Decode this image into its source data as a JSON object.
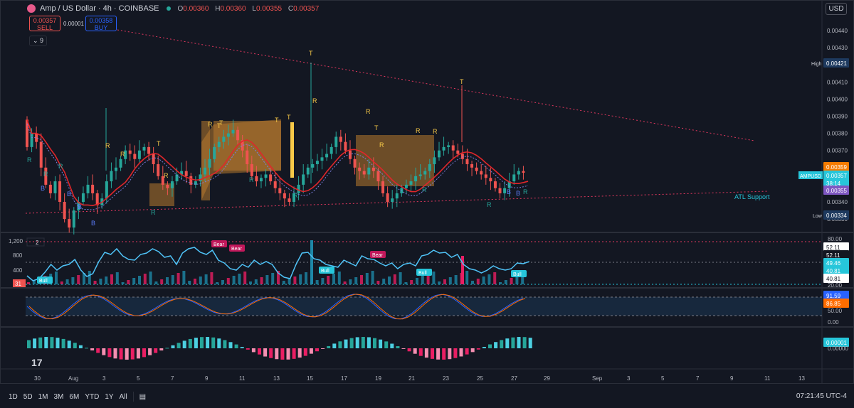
{
  "header": {
    "symbol": "Amp / US Dollar · 4h · COINBASE",
    "o_label": "O",
    "o_value": "0.00360",
    "h_label": "H",
    "h_value": "0.00360",
    "l_label": "L",
    "l_value": "0.00355",
    "c_label": "C",
    "c_value": "0.00357"
  },
  "trade": {
    "sell_price": "0.00357",
    "sell_label": "SELL",
    "buy_price": "0.00358",
    "buy_label": "BUY",
    "spread": "0.00001"
  },
  "collapse_label": "9",
  "currency": "USD",
  "price_axis": {
    "ticks": [
      "0.00440",
      "0.00430",
      "0.00420",
      "0.00410",
      "0.00400",
      "0.00390",
      "0.00380",
      "0.00370",
      "0.00360",
      "0.00350",
      "0.00340",
      "0.00330"
    ],
    "high_label": "High",
    "high_value": "0.00421",
    "low_label": "Low",
    "low_value": "0.00334",
    "tag_orange": "0.00359",
    "tag_symbol": "AMPUSD",
    "tag_price": "0.00357",
    "tag_timer": "38:14",
    "tag_purple": "0.00355"
  },
  "annotations": {
    "atl_support": "ATL Support",
    "t": "T",
    "r": "R",
    "b": "B"
  },
  "indicator1": {
    "pane_label": "2",
    "ticks": [
      "1,200",
      "800",
      "400"
    ],
    "value_badge": "31",
    "axis_top": "80.00",
    "tag1": "52.11",
    "tag2": "52.11",
    "tag3": "49.46",
    "tag4": "40.81",
    "tag5": "40.81",
    "axis_bottom": "20.00",
    "bull": "Bull",
    "bear": "Bear"
  },
  "indicator2": {
    "tag1": "91.59",
    "tag2": "86.85",
    "axis_mid": "50.00",
    "axis_bottom": "0.00"
  },
  "indicator3": {
    "tag1": "0.00001",
    "axis": "0.00000"
  },
  "time_axis": [
    "30",
    "Aug",
    "3",
    "5",
    "7",
    "9",
    "11",
    "13",
    "15",
    "17",
    "19",
    "21",
    "23",
    "25",
    "27",
    "29",
    "Sep",
    "3",
    "5",
    "7",
    "9",
    "11",
    "13"
  ],
  "timeframes": [
    "1D",
    "5D",
    "1M",
    "3M",
    "6M",
    "YTD",
    "1Y",
    "All"
  ],
  "clock": "07:21:45 UTC-4",
  "colors": {
    "bg": "#131722",
    "bull": "#26a69a",
    "bear": "#ef5350",
    "ema_red": "#e0262b",
    "ema_green": "#4caf50",
    "band": "#b87a2e",
    "cyan": "#4fc3f7",
    "pink": "#e91e63"
  }
}
